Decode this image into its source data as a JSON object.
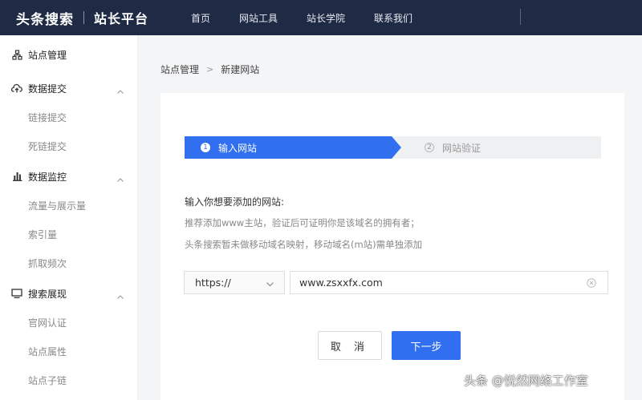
{
  "brand": {
    "name": "头条搜索",
    "subtitle": "站长平台"
  },
  "nav": {
    "items": [
      "首页",
      "网站工具",
      "站长学院",
      "联系我们"
    ]
  },
  "sidebar": {
    "site_manage": "站点管理",
    "data_submit": {
      "label": "数据提交",
      "items": [
        "链接提交",
        "死链提交"
      ]
    },
    "data_monitor": {
      "label": "数据监控",
      "items": [
        "流量与展示量",
        "索引量",
        "抓取频次"
      ]
    },
    "search_display": {
      "label": "搜索展现",
      "items": [
        "官网认证",
        "站点属性",
        "站点子链"
      ]
    }
  },
  "breadcrumb": {
    "parent": "站点管理",
    "current": "新建网站"
  },
  "steps": [
    {
      "num": "1",
      "label": "输入网站"
    },
    {
      "num": "2",
      "label": "网站验证"
    }
  ],
  "instructions": {
    "title": "输入你想要添加的网站:",
    "line1": "推荐添加www主站，验证后可证明你是该域名的拥有者；",
    "line2": "头条搜索暂未做移动域名映射，移动域名(m站)需单独添加"
  },
  "form": {
    "protocol": "https://",
    "url": "www.zsxxfx.com"
  },
  "buttons": {
    "cancel": "取 消",
    "next": "下一步"
  },
  "watermark": "头条 @悦然网络工作室",
  "colors": {
    "topbar": "#1f2a44",
    "accent": "#2f6ff0"
  }
}
